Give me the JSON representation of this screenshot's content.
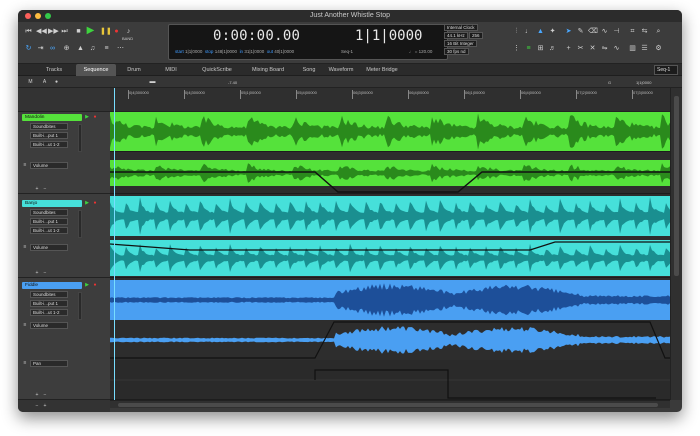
{
  "window": {
    "title": "Just Another Whistle Stop"
  },
  "colors": {
    "green_clip": "#55e23b",
    "green_wave": "#2a8a1c",
    "cyan_clip": "#46e0da",
    "cyan_wave": "#1a8f90",
    "blue_clip": "#4a9ff2",
    "blue_wave": "#1d4f99",
    "accent": "#3f9bff"
  },
  "transport": {
    "rewind_icon": "rewind-icon",
    "play_icon": "play-icon",
    "record_icon": "record-icon",
    "stop_icon": "stop-icon",
    "pause_icon": "pause-icon",
    "loop_icon": "loop-icon",
    "band_label": "BAND"
  },
  "counter": {
    "time": "0:00:00.00",
    "bars": "1|1|0000",
    "start_label": "start",
    "start_value": "1|1|0000",
    "stop_label": "stop",
    "stop_value": "148|1|0000",
    "in_label": "in",
    "in_value": "31|1|0000",
    "out_label": "out",
    "out_value": "40|1|0000",
    "seq_label": "Seq-1",
    "tempo_label": "♩ = 120.00"
  },
  "info": {
    "clock": "Internal Clock",
    "rate": "44.1 kHz",
    "buffer": "256",
    "depth": "16 Bit Integer",
    "fps": "30 fps nd"
  },
  "tabs": [
    {
      "label": "Tracks"
    },
    {
      "label": "Sequence"
    },
    {
      "label": "Drum"
    },
    {
      "label": "MIDI"
    },
    {
      "label": "QuickScribe"
    },
    {
      "label": "Mixing Board"
    },
    {
      "label": "Song"
    },
    {
      "label": "Waveform"
    },
    {
      "label": "Meter Bridge"
    }
  ],
  "seq_selector": "Seq-1",
  "toolbar2": {
    "m": "M",
    "a": "A",
    "level": "-7.40",
    "g": "G",
    "counter": "1|1|0000"
  },
  "ruler": [
    "0|4|300000",
    "0|4|300000",
    "05|1|00000",
    "05|4|00000",
    "06|3|00000",
    "06|4|00000",
    "06|1|00000",
    "06|4|00000",
    "07|2|00000",
    "07|3|00000"
  ],
  "tracks": [
    {
      "name": "Mandolin",
      "input": "Soundbites",
      "output": "Built-i...put 1",
      "output2": "Built-i...ut 1-2",
      "lane2": "Volume"
    },
    {
      "name": "Banjo",
      "input": "Soundbites",
      "output": "Built-i...put 1",
      "output2": "Built-i...ut 1-2",
      "lane2": "Volume"
    },
    {
      "name": "Fiddle",
      "input": "Soundbites",
      "output": "Built-i...put 1",
      "output2": "Built-i...ut 1-2",
      "lane2": "Volume",
      "lane3": "Pan"
    }
  ]
}
